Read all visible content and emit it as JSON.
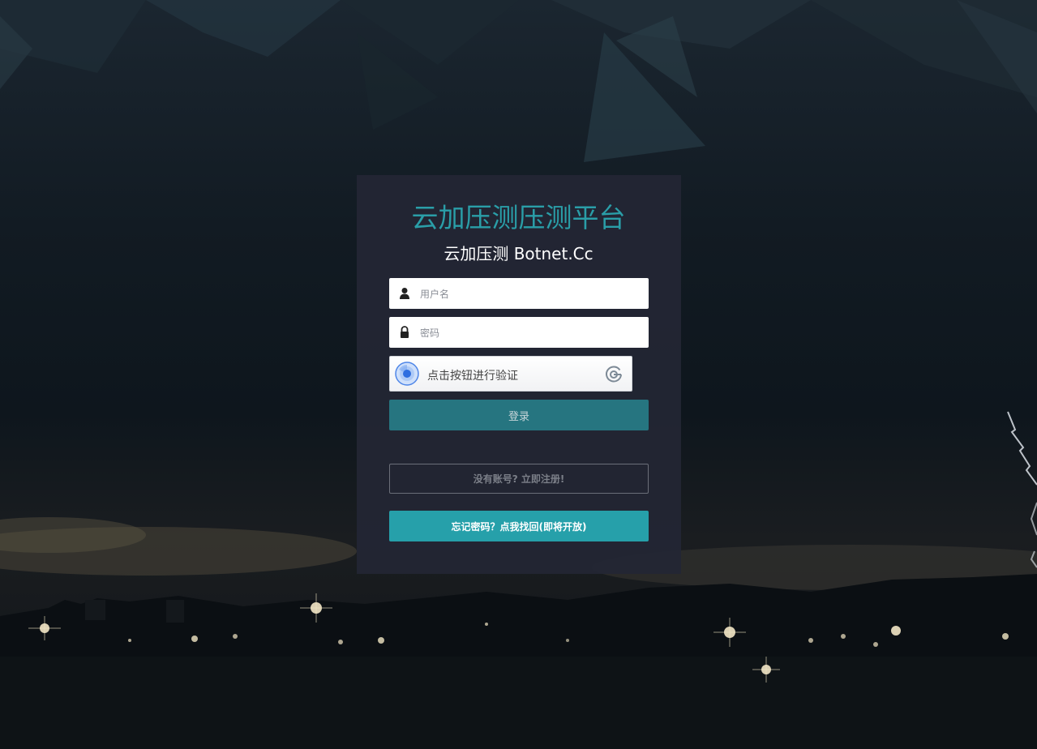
{
  "login": {
    "title": "云加压测压测平台",
    "subtitle": "云加压测 Botnet.Cc",
    "username": {
      "placeholder": "用户名",
      "value": "",
      "icon": "user-icon"
    },
    "password": {
      "placeholder": "密码",
      "value": "",
      "icon": "lock-icon"
    },
    "captcha": {
      "label": "点击按钮进行验证",
      "icon": "captcha-disc-icon",
      "logo": "captcha-logo-icon"
    },
    "login_button": "登录",
    "register_button": "没有账号? 立即注册!",
    "forgot_button": "忘记密码？点我找回(即将开放)"
  },
  "colors": {
    "accent": "#2a9ea8",
    "login_button_bg": "#267580",
    "forgot_button_bg": "#26a0aa",
    "panel_bg": "#232634"
  }
}
